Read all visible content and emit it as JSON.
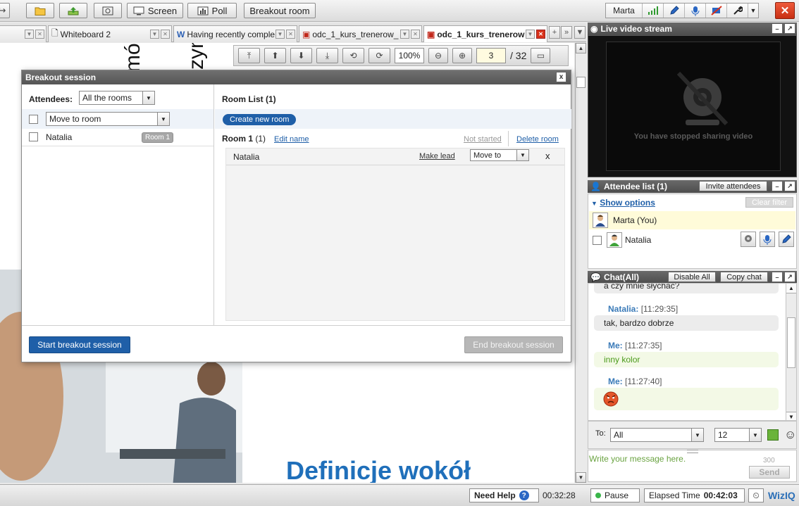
{
  "toolbar": {
    "screen_label": "Screen",
    "poll_label": "Poll",
    "breakout_label": "Breakout room",
    "user_name": "Marta",
    "close_label": "✕"
  },
  "tabs": [
    {
      "label": "Whiteboard 2"
    },
    {
      "label": "Having recently comple"
    },
    {
      "label": "odc_1_kurs_trenerow_"
    },
    {
      "label": "odc_1_kurs_trenerow"
    }
  ],
  "tab_nav": {
    "add": "+",
    "more": "▼"
  },
  "doc_toolbar": {
    "zoom": "100%",
    "page": "3",
    "total_pages": "/ 32"
  },
  "whiteboard": {
    "rotated_text_1": "mó",
    "rotated_text_2": "zym",
    "heading": "Definicje wokół"
  },
  "breakout": {
    "title": "Breakout session",
    "close": "x",
    "attendees_label": "Attendees:",
    "attendees_filter": "All the rooms",
    "move_to_room": "Move to room",
    "attendee_name": "Natalia",
    "attendee_room_badge": "Room 1",
    "room_list_title": "Room List (1)",
    "create_room": "Create new room",
    "room_name": "Room 1",
    "room_count": "(1)",
    "edit_name": "Edit name",
    "not_started": "Not started",
    "delete_room": "Delete room",
    "member_name": "Natalia",
    "make_lead": "Make lead",
    "move_to": "Move to",
    "remove": "x",
    "start_button": "Start breakout session",
    "end_button": "End breakout session"
  },
  "video": {
    "title": "Live video stream",
    "message": "You have stopped sharing video"
  },
  "attendee_list": {
    "title": "Attendee list (1)",
    "invite": "Invite attendees",
    "show_options": "Show options",
    "clear_filter": "Clear filter",
    "self_name": "Marta (You)",
    "other_name": "Natalia"
  },
  "chat": {
    "title": "Chat(All)",
    "disable_all": "Disable All",
    "copy_chat": "Copy chat",
    "partial_message": "a czy mnie słychać?",
    "messages": [
      {
        "author": "Natalia:",
        "time": "[11:29:35]",
        "text": "tak, bardzo dobrze"
      },
      {
        "author": "Me:",
        "time": "[11:27:35]",
        "text": "inny kolor"
      },
      {
        "author": "Me:",
        "time": "[11:27:40]",
        "text": ""
      }
    ],
    "to_label": "To:",
    "to_value": "All",
    "font_size": "12",
    "input_placeholder": "Write your message here.",
    "char_count": "300",
    "send": "Send"
  },
  "bottombar": {
    "need_help": "Need Help",
    "help_icon": "?",
    "session_time": "00:32:28",
    "pause": "Pause",
    "elapsed_label": "Elapsed Time",
    "elapsed_value": "00:42:03",
    "brand": "WizIQ"
  },
  "colors": {
    "accent_blue": "#1f5fa8",
    "heading_blue": "#1f6fba",
    "chat_name": "#3a7ab8",
    "close_red": "#d9321b"
  }
}
